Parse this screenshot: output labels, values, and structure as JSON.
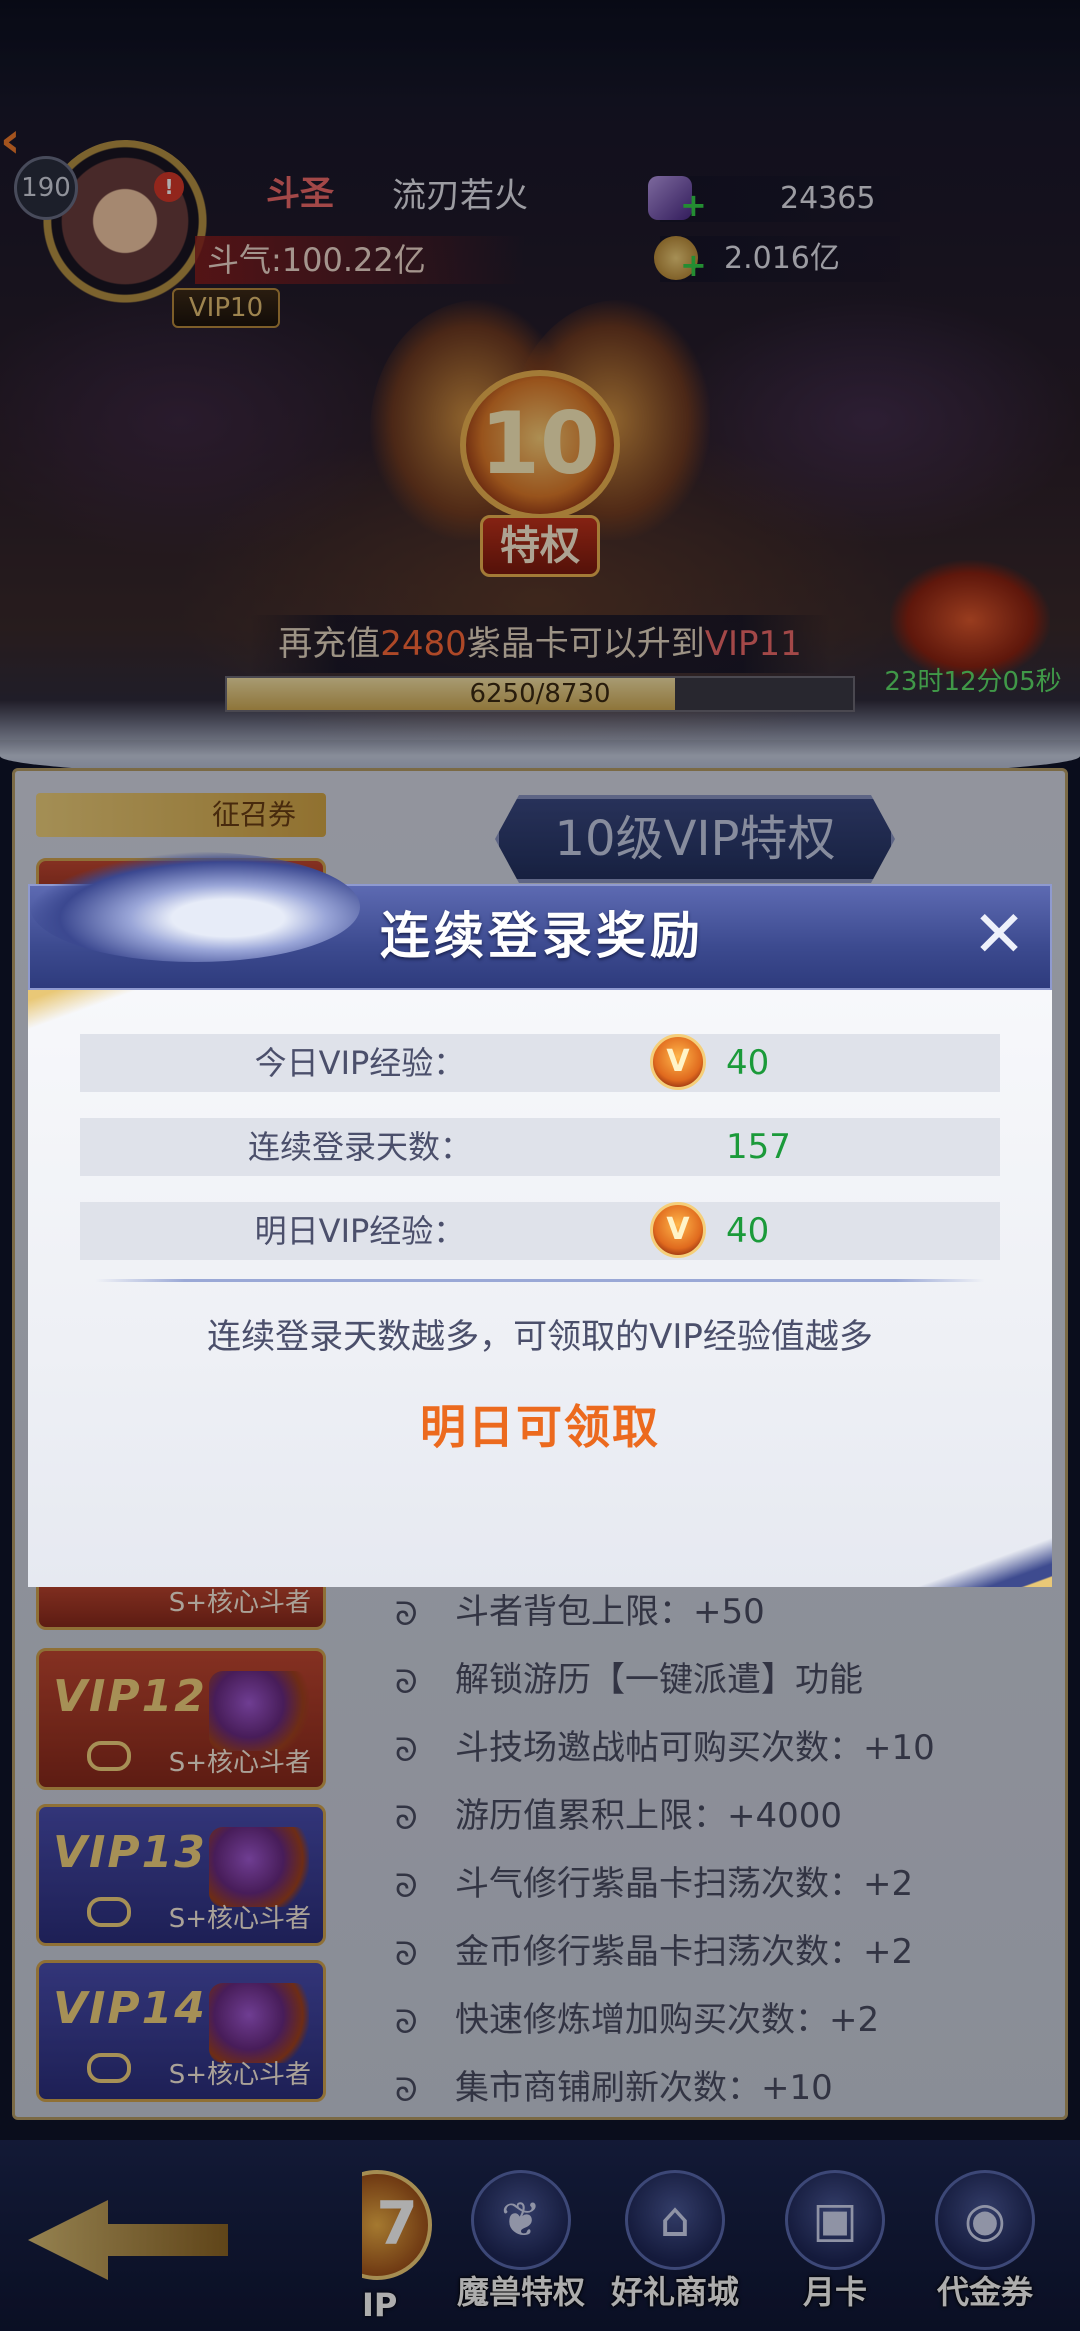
{
  "player": {
    "level": "190",
    "title": "斗圣",
    "name": "流刃若火",
    "power": "斗气:100.22亿",
    "vip_badge": "VIP10",
    "alert": "!"
  },
  "resources": {
    "crystal": "24365",
    "gold": "2.016亿"
  },
  "vip_emblem": {
    "level": "10",
    "label": "特权"
  },
  "upgrade": {
    "prefix": "再充值",
    "amount": "2480",
    "middle": "紫晶卡可以升到",
    "target": "VIP11",
    "progress_text": "6250/8730",
    "progress": 0.716
  },
  "timer": "23时12分05秒",
  "left_panel": {
    "recruit_tag": "征召券",
    "cards": [
      {
        "title": "VIP12",
        "sub": "S+核心斗者"
      },
      {
        "title": "VIP13",
        "sub": "S+核心斗者"
      },
      {
        "title": "VIP14",
        "sub": "S+核心斗者"
      }
    ],
    "partial_card_sub": "S+核心斗者"
  },
  "vip_header": "10级VIP特权",
  "privileges": [
    "斗者背包上限：+50",
    "解锁游历【一键派遣】功能",
    "斗技场邀战帖可购买次数：+10",
    "游历值累积上限：+4000",
    "斗气修行紫晶卡扫荡次数：+2",
    "金币修行紫晶卡扫荡次数：+2",
    "快速修炼增加购买次数：+2",
    "集市商铺刷新次数：+10"
  ],
  "bottom_nav": {
    "vip_partial": "IP",
    "items": [
      {
        "label": "魔兽特权",
        "icon": "beast-icon"
      },
      {
        "label": "好礼商城",
        "icon": "shop-icon"
      },
      {
        "label": "月卡",
        "icon": "month-card-icon"
      },
      {
        "label": "代金券",
        "icon": "voucher-icon"
      }
    ]
  },
  "modal": {
    "title": "连续登录奖励",
    "rows": [
      {
        "label": "今日VIP经验：",
        "value": "40",
        "medal": "V"
      },
      {
        "label": "连续登录天数：",
        "value": "157"
      },
      {
        "label": "明日VIP经验：",
        "value": "40",
        "medal": "V"
      }
    ],
    "note": "连续登录天数越多，可领取的VIP经验值越多",
    "claim": "明日可领取"
  },
  "colors": {
    "modal_header": "#3c4a8f",
    "value_green": "#1b9a3a",
    "claim_orange": "#ec6a1e",
    "progress_gold": "#d2ad56",
    "timer_green": "#5fe16a"
  }
}
